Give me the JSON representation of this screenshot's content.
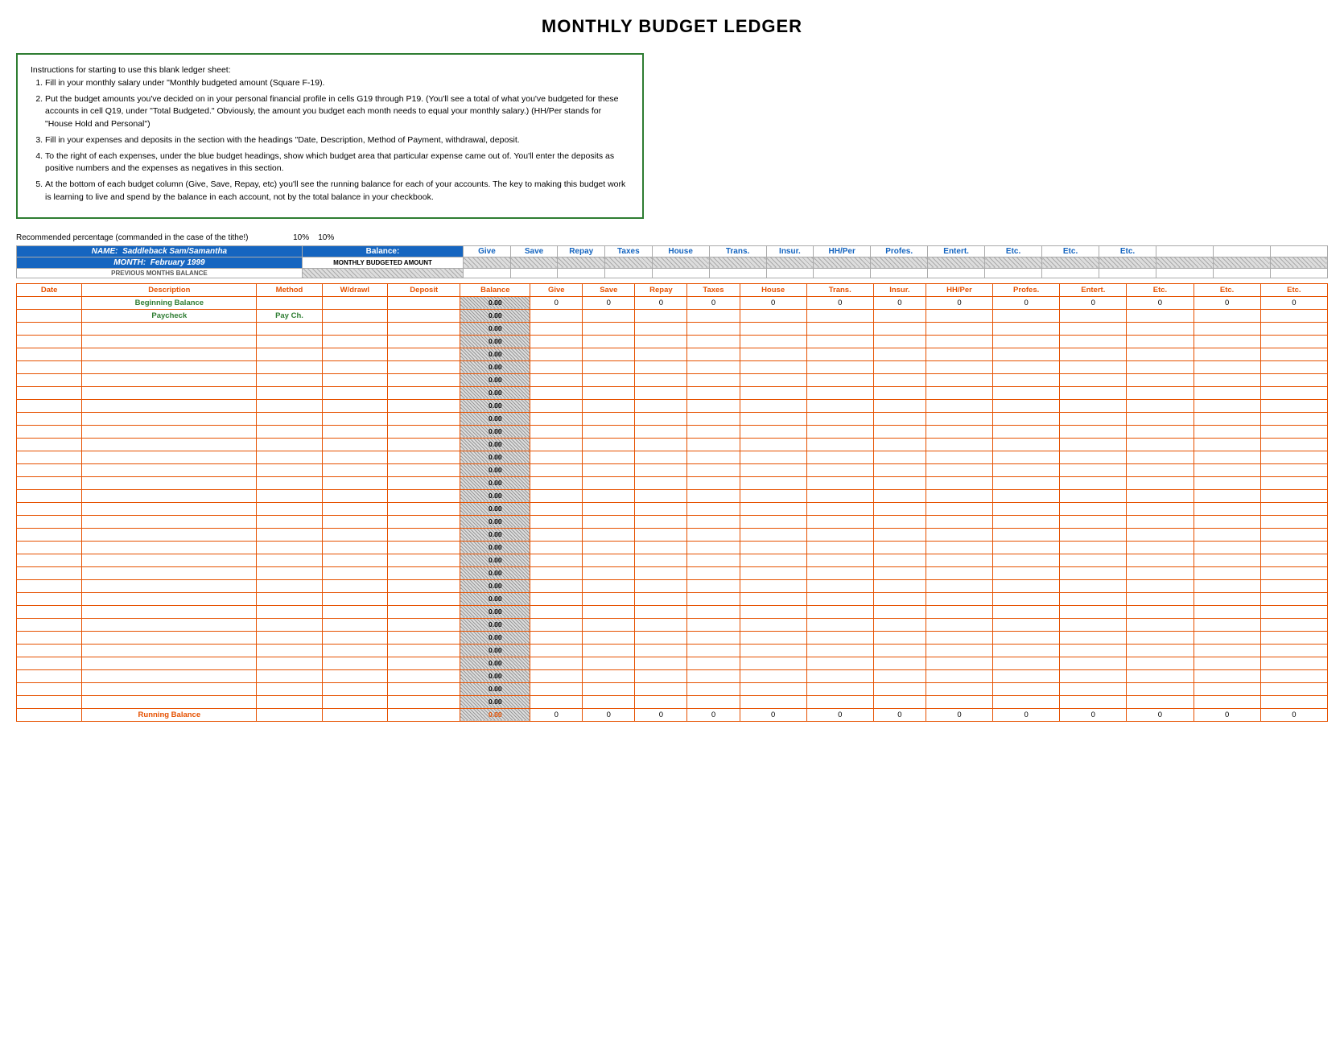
{
  "title": "MONTHLY BUDGET LEDGER",
  "instructions": {
    "intro": "Instructions for starting to use this blank ledger sheet:",
    "steps": [
      "Fill in your monthly salary under \"Monthly budgeted amount (Square F-19).",
      "Put the budget amounts you've decided on in your personal financial profile in cells G19 through P19.  (You'll see a total of what you've budgeted for these accounts in cell Q19, under \"Total Budgeted.\"  Obviously, the amount you budget each month needs to equal your monthly salary.)     (HH/Per stands for \"House Hold and Personal\")",
      "Fill in your expenses and deposits in the section with the headings \"Date, Description, Method of Payment, withdrawal, deposit.",
      "To the right of each expenses, under the blue budget headings, show which budget area that particular expense came out of.  You'll enter the deposits as positive numbers and the expenses as negatives in this section.",
      "At the bottom of each budget column (Give, Save, Repay, etc) you'll see the running balance for each of your accounts.  The key to making this budget work is learning to live and spend by the balance in each account, not by the total balance in your checkbook."
    ]
  },
  "rec_percent_label": "Recommended percentage (commanded in the case of the tithe!)",
  "rec_percent_val1": "10%",
  "rec_percent_val2": "10%",
  "header": {
    "name_label": "NAME:",
    "name_value": "Saddleback Sam/Samantha",
    "balance_label": "Balance:",
    "month_label": "MONTH:",
    "month_value": "February 1999",
    "monthly_budgeted": "MONTHLY BUDGETED AMOUNT",
    "prev_balance": "PREVIOUS MONTHS BALANCE"
  },
  "columns": {
    "give": "Give",
    "save": "Save",
    "repay": "Repay",
    "taxes": "Taxes",
    "house": "House",
    "trans": "Trans.",
    "insur": "Insur.",
    "hhper": "HH/Per",
    "profes": "Profes.",
    "entert": "Entert.",
    "etc1": "Etc.",
    "etc2": "Etc.",
    "etc3": "Etc."
  },
  "ledger_headers": {
    "date": "Date",
    "description": "Description",
    "method": "Method",
    "wdrawl": "W/drawl",
    "deposit": "Deposit",
    "balance": "Balance",
    "give": "Give",
    "save": "Save",
    "repay": "Repay",
    "taxes": "Taxes",
    "house": "House",
    "trans": "Trans.",
    "insur": "Insur.",
    "hhper": "HH/Per",
    "profes": "Profes.",
    "entert": "Entert.",
    "etc1": "Etc.",
    "etc2": "Etc.",
    "etc3": "Etc."
  },
  "rows": {
    "beginning_balance": "Beginning Balance",
    "paycheck": "Paycheck",
    "paycheck_method": "Pay Ch.",
    "running_balance": "Running Balance",
    "balance_val": "0.00",
    "zero": "0"
  },
  "data_rows_count": 30
}
